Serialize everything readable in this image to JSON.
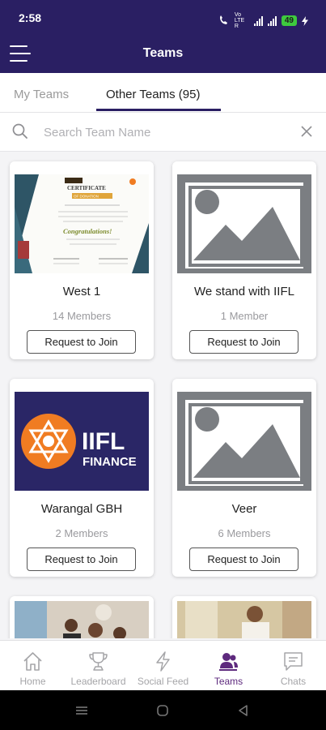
{
  "status_bar": {
    "time": "2:58",
    "network": "Vo LTE R",
    "battery": "49"
  },
  "app_bar": {
    "title": "Teams"
  },
  "tabs": [
    {
      "label": "My Teams",
      "active": false
    },
    {
      "label": "Other Teams (95)",
      "active": true
    }
  ],
  "search": {
    "placeholder": "Search Team Name",
    "value": ""
  },
  "teams": [
    {
      "name": "West 1",
      "members": "14 Members",
      "action": "Request to Join",
      "image": "certificate-image"
    },
    {
      "name": "We stand with IIFL",
      "members": "1 Member",
      "action": "Request to Join",
      "image": "placeholder-image"
    },
    {
      "name": "Warangal GBH",
      "members": "2 Members",
      "action": "Request to Join",
      "image": "iifl-finance-logo",
      "logo": {
        "brand": "IIFL",
        "sub": "FINANCE",
        "bg": "#2a2666",
        "accent": "#f07c22"
      }
    },
    {
      "name": "Veer",
      "members": "6 Members",
      "action": "Request to Join",
      "image": "placeholder-image"
    }
  ],
  "certificate": {
    "heading": "CERTIFICATE",
    "subheading": "OF DONATION",
    "congrats": "Congratulations!"
  },
  "bottom_nav": [
    {
      "label": "Home",
      "icon": "home-icon",
      "active": false
    },
    {
      "label": "Leaderboard",
      "icon": "trophy-icon",
      "active": false
    },
    {
      "label": "Social Feed",
      "icon": "lightning-icon",
      "active": false
    },
    {
      "label": "Teams",
      "icon": "teams-icon",
      "active": true
    },
    {
      "label": "Chats",
      "icon": "chat-icon",
      "active": false
    }
  ],
  "colors": {
    "primary": "#2a1f63",
    "active_nav": "#5e2a7e",
    "muted": "#9a9a9e",
    "placeholder_gray": "#7b7e82"
  }
}
